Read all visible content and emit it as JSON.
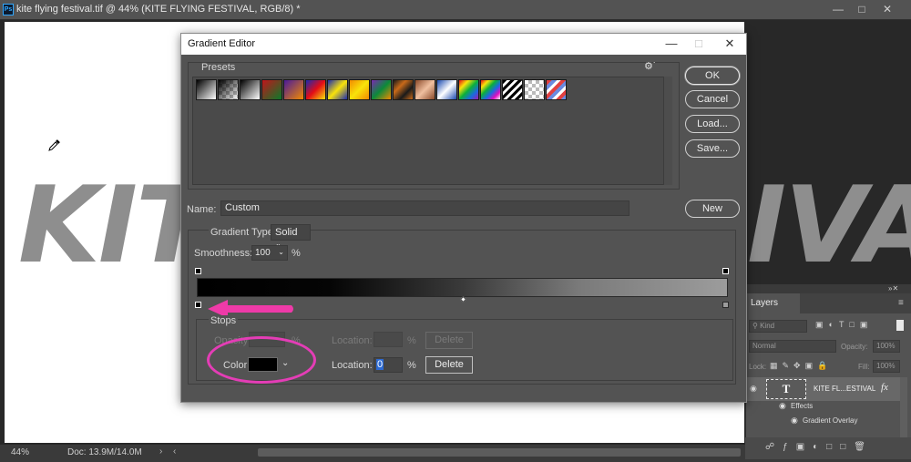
{
  "window": {
    "title": "kite flying festival.tif @ 44% (KITE FLYING FESTIVAL, RGB/8) *",
    "app_icon": "Ps"
  },
  "status": {
    "zoom": "44%",
    "doc_size": "Doc: 13.9M/14.0M"
  },
  "canvas": {
    "left_text": "KITE",
    "right_text": "IVAL"
  },
  "dialog": {
    "title": "Gradient Editor",
    "presets_label": "Presets",
    "buttons": {
      "ok": "OK",
      "cancel": "Cancel",
      "load": "Load...",
      "save": "Save...",
      "new": "New"
    },
    "name_label": "Name:",
    "name_value": "Custom",
    "gradient_type_label": "Gradient Type:",
    "gradient_type_value": "Solid",
    "smoothness_label": "Smoothness:",
    "smoothness_value": "100",
    "smoothness_unit": "%",
    "stops_label": "Stops",
    "opacity_label": "Opacity:",
    "opacity_unit": "%",
    "location_label": "Location:",
    "location_unit": "%",
    "delete_label": "Delete",
    "color_label": "Color:",
    "color_value": "#000000",
    "location_value": "0"
  },
  "layers": {
    "tab": "Layers",
    "kind_filter": "Kind",
    "blend_mode": "Normal",
    "opacity_label": "Opacity:",
    "opacity_value": "100%",
    "lock_label": "Lock:",
    "fill_label": "Fill:",
    "fill_value": "100%",
    "layer_name": "KITE FL...ESTIVAL",
    "layer_thumb": "T",
    "fx_label": "fx",
    "effects_label": "Effects",
    "gradient_overlay_label": "Gradient Overlay"
  }
}
